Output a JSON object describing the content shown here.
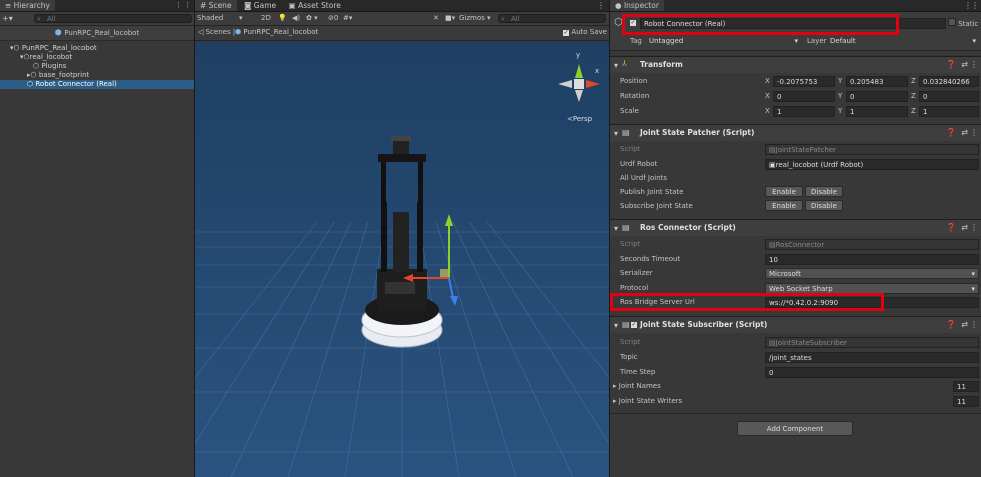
{
  "hierarchy": {
    "tab_label": "Hierarchy",
    "add_label": "+▾",
    "search_placeholder": "All",
    "scene_name": "PunRPC_Real_locobot",
    "items": [
      {
        "label": "PunRPC_Real_locobot"
      },
      {
        "label": "real_locobot"
      },
      {
        "label": "Plugins"
      },
      {
        "label": "base_footprint"
      },
      {
        "label": "Robot Connector (Real)"
      }
    ]
  },
  "scene": {
    "tabs": [
      {
        "label": "Scene"
      },
      {
        "label": "Game"
      },
      {
        "label": "Asset Store"
      }
    ],
    "shading": "Shaded",
    "mode_2d": "2D",
    "gizmos": "Gizmos",
    "search_placeholder": "All",
    "breadcrumb_root": "Scenes",
    "breadcrumb_scene": "PunRPC_Real_locobot",
    "auto_save": "Auto Save",
    "persp": "Persp",
    "axis_y": "y",
    "axis_x": "x"
  },
  "inspector": {
    "tab_label": "Inspector",
    "object_name": "Robot Connector (Real)",
    "static_label": "Static",
    "tag_label": "Tag",
    "tag_value": "Untagged",
    "layer_label": "Layer",
    "layer_value": "Default",
    "transform": {
      "title": "Transform",
      "rows": [
        {
          "label": "Position",
          "x": "-0.2075753",
          "y": "0.205483",
          "z": "0.032840266"
        },
        {
          "label": "Rotation",
          "x": "0",
          "y": "0",
          "z": "0"
        },
        {
          "label": "Scale",
          "x": "1",
          "y": "1",
          "z": "1"
        }
      ]
    },
    "jsp": {
      "title": "Joint State Patcher (Script)",
      "script_label": "Script",
      "script_value": "JointStatePatcher",
      "urdf_label": "Urdf Robot",
      "urdf_value": "real_locobot (Urdf Robot)",
      "all_joints": "All Urdf Joints",
      "publish_label": "Publish Joint State",
      "subscribe_label": "Subscribe Joint State",
      "enable": "Enable",
      "disable": "Disable"
    },
    "ros": {
      "title": "Ros Connector (Script)",
      "script_label": "Script",
      "script_value": "RosConnector",
      "timeout_label": "Seconds Timeout",
      "timeout_value": "10",
      "serializer_label": "Serializer",
      "serializer_value": "Microsoft",
      "protocol_label": "Protocol",
      "protocol_value": "Web Socket Sharp",
      "url_label": "Ros Bridge Server Url",
      "url_value": "ws://*0.42.0.2:9090"
    },
    "jss": {
      "title": "Joint State Subscriber (Script)",
      "script_label": "Script",
      "script_value": "JointStateSubscriber",
      "topic_label": "Topic",
      "topic_value": "/joint_states",
      "timestep_label": "Time Step",
      "timestep_value": "0",
      "joint_names_label": "Joint Names",
      "joint_names_count": "11",
      "writers_label": "Joint State Writers",
      "writers_count": "11"
    },
    "add_component": "Add Component"
  },
  "colors": {
    "highlight": "#e3000f",
    "selection": "#2c5d87",
    "scene_bg": "#24466b"
  }
}
